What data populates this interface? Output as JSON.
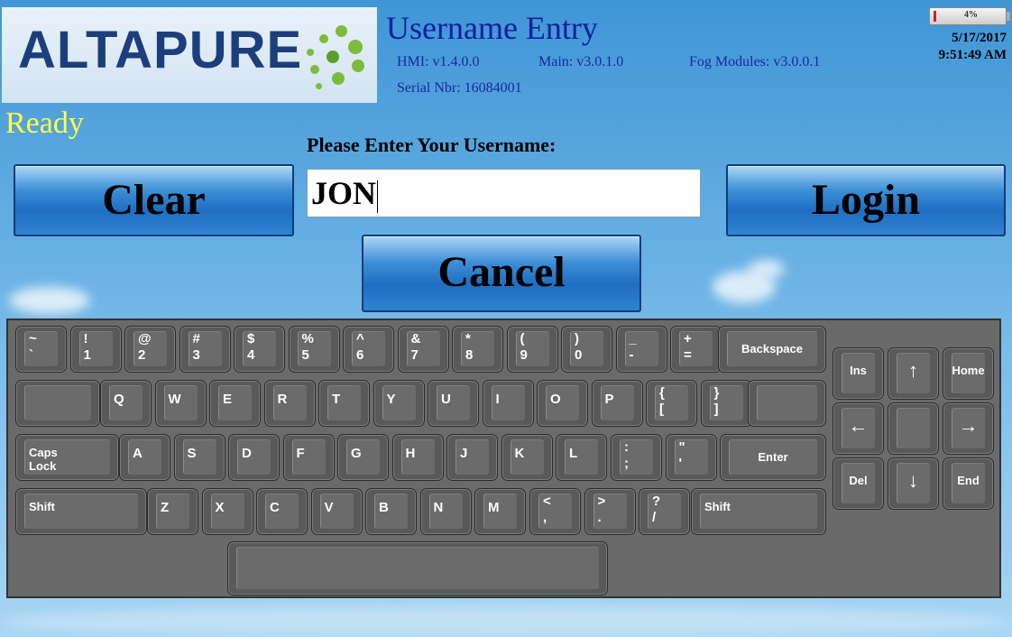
{
  "header": {
    "logo_text": "ALTAPURE",
    "title": "Username Entry",
    "hmi_version": "HMI: v1.4.0.0",
    "main_version": "Main: v3.0.1.0",
    "fog_version": "Fog Modules: v3.0.0.1",
    "serial": "Serial  Nbr: 16084001",
    "battery_percent": "4%",
    "battery_level": 0.04,
    "date": "5/17/2017",
    "time": "9:51:49 AM"
  },
  "status": "Ready",
  "prompt": "Please Enter Your Username:",
  "username": {
    "value": "JON"
  },
  "buttons": {
    "clear": "Clear",
    "login": "Login",
    "cancel": "Cancel"
  },
  "keyboard": {
    "row1": [
      {
        "top": "~",
        "bot": "`"
      },
      {
        "top": "!",
        "bot": "1"
      },
      {
        "top": "@",
        "bot": "2"
      },
      {
        "top": "#",
        "bot": "3"
      },
      {
        "top": "$",
        "bot": "4"
      },
      {
        "top": "%",
        "bot": "5"
      },
      {
        "top": "^",
        "bot": "6"
      },
      {
        "top": "&",
        "bot": "7"
      },
      {
        "top": "*",
        "bot": "8"
      },
      {
        "top": "(",
        "bot": "9"
      },
      {
        "top": ")",
        "bot": "0"
      },
      {
        "top": "_",
        "bot": "-"
      },
      {
        "top": "+",
        "bot": "="
      }
    ],
    "backspace": "Backspace",
    "row2": [
      "Q",
      "W",
      "E",
      "R",
      "T",
      "Y",
      "U",
      "I",
      "O",
      "P"
    ],
    "row2_brackets": [
      {
        "top": "{",
        "bot": "["
      },
      {
        "top": "}",
        "bot": "]"
      }
    ],
    "caps_lock": "Caps\nLock",
    "row3": [
      "A",
      "S",
      "D",
      "F",
      "G",
      "H",
      "J",
      "K",
      "L"
    ],
    "row3_punct": [
      {
        "top": ":",
        "bot": ";"
      },
      {
        "top": "\"",
        "bot": "'"
      }
    ],
    "enter": "Enter",
    "shift": "Shift",
    "row4": [
      "Z",
      "X",
      "C",
      "V",
      "B",
      "N",
      "M"
    ],
    "row4_punct": [
      {
        "top": "<",
        "bot": ","
      },
      {
        "top": ">",
        "bot": "."
      },
      {
        "top": "?",
        "bot": "/"
      }
    ],
    "nav": {
      "ins": "Ins",
      "home": "Home",
      "del": "Del",
      "end": "End",
      "up": "↑",
      "down": "↓",
      "left": "←",
      "right": "→"
    }
  }
}
